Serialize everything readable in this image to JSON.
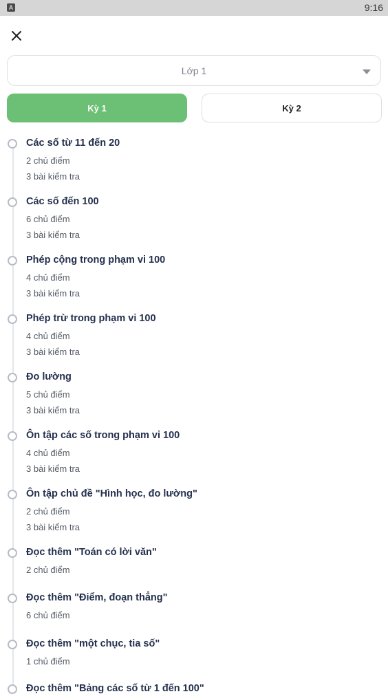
{
  "status_bar": {
    "time": "9:16",
    "app_icon": "A"
  },
  "header": {
    "close_icon": "close-icon"
  },
  "grade_select": {
    "value": "Lớp 1"
  },
  "term_tabs": [
    {
      "label": "Kỳ 1",
      "active": true
    },
    {
      "label": "Kỳ 2",
      "active": false
    }
  ],
  "chapters": [
    {
      "title": "Các số từ 11 đến 20",
      "topics": "2 chủ điểm",
      "tests": "3 bài kiểm tra"
    },
    {
      "title": "Các số đến 100",
      "topics": "6 chủ điểm",
      "tests": "3 bài kiểm tra"
    },
    {
      "title": "Phép cộng trong phạm vi 100",
      "topics": "4 chủ điểm",
      "tests": "3 bài kiểm tra"
    },
    {
      "title": "Phép trừ trong phạm vi 100",
      "topics": "4 chủ điểm",
      "tests": "3 bài kiểm tra"
    },
    {
      "title": "Đo lường",
      "topics": "5 chủ điểm",
      "tests": "3 bài kiểm tra"
    },
    {
      "title": "Ôn tập các số trong phạm vi 100",
      "topics": "4 chủ điểm",
      "tests": "3 bài kiểm tra"
    },
    {
      "title": "Ôn tập chủ đề \"Hình học, đo lường\"",
      "topics": "2 chủ điểm",
      "tests": "3 bài kiểm tra"
    },
    {
      "title": "Đọc thêm \"Toán có lời văn\"",
      "topics": "2 chủ điểm"
    },
    {
      "title": "Đọc thêm \"Điểm, đoạn thẳng\"",
      "topics": "6 chủ điểm"
    },
    {
      "title": "Đọc thêm \"một chục, tia số\"",
      "topics": "1 chủ điểm"
    },
    {
      "title": "Đọc thêm \"Bảng các số từ 1 đến 100\""
    }
  ],
  "colors": {
    "accent": "#6cc075",
    "title": "#24304d",
    "muted": "#555b66"
  }
}
